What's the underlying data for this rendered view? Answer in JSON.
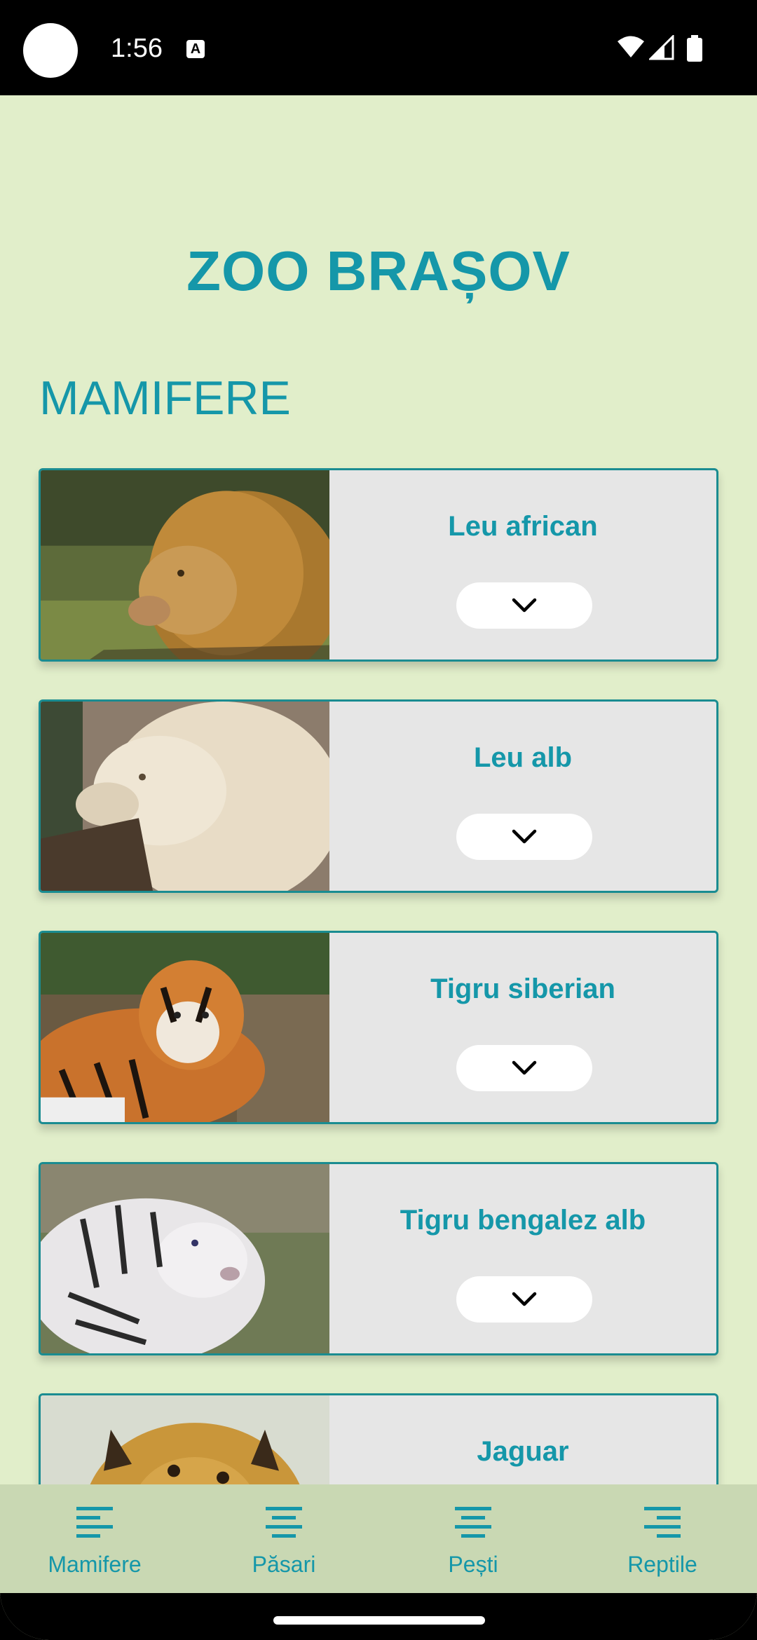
{
  "status_bar": {
    "time": "1:56",
    "notification_icon": "A"
  },
  "app": {
    "title": "ZOO BRAȘOV",
    "section_title": "MAMIFERE",
    "accent_color": "#1597a9",
    "background_color": "#e1eeca"
  },
  "animals": [
    {
      "name": "Leu african",
      "image": "african-lion-photo"
    },
    {
      "name": "Leu alb",
      "image": "white-lion-photo"
    },
    {
      "name": "Tigru siberian",
      "image": "siberian-tiger-photo"
    },
    {
      "name": "Tigru bengalez alb",
      "image": "white-bengal-tiger-photo"
    },
    {
      "name": "Jaguar",
      "image": "jaguar-photo"
    }
  ],
  "bottom_nav": {
    "items": [
      {
        "label": "Mamifere",
        "icon": "align-left-icon"
      },
      {
        "label": "Păsari",
        "icon": "align-center-icon"
      },
      {
        "label": "Pești",
        "icon": "align-center-icon"
      },
      {
        "label": "Reptile",
        "icon": "align-right-icon"
      }
    ]
  }
}
